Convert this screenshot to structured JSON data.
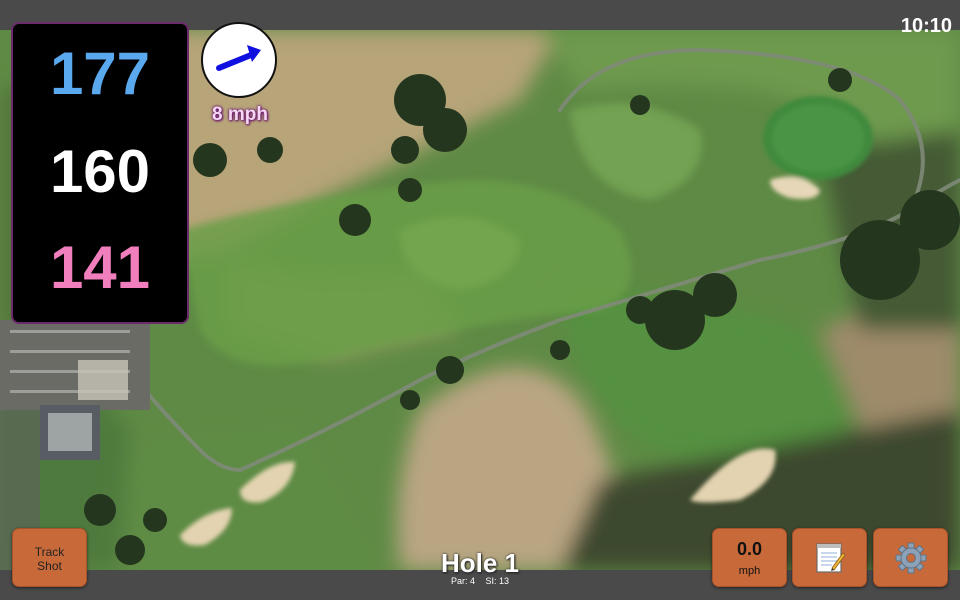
{
  "status_bar": {
    "time": "10:10"
  },
  "distances": {
    "back": "177",
    "middle": "160",
    "front": "141"
  },
  "wind": {
    "speed_label": "8 mph",
    "direction_icon": "arrow-icon"
  },
  "buttons": {
    "track_shot_label": "Track\nShot",
    "speed_value": "0.0",
    "speed_unit": "mph",
    "notes_icon": "notepad-icon",
    "settings_icon": "gear-icon"
  },
  "hole": {
    "title": "Hole 1",
    "par": "Par: 4",
    "si": "SI: 13"
  },
  "colors": {
    "back_distance": "#5aa8ee",
    "middle_distance": "#ffffff",
    "front_distance": "#f27fbd",
    "button": "#c8693a",
    "wind_arrow": "#1010e0"
  }
}
